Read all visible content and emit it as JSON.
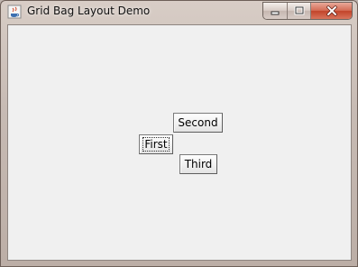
{
  "window": {
    "title": "Grid Bag Layout Demo",
    "controls": [
      "minimize-icon",
      "maximize-icon",
      "close-icon"
    ]
  },
  "buttons": {
    "second": "Second",
    "first": "First",
    "third": "Third"
  },
  "focused_button": "First"
}
